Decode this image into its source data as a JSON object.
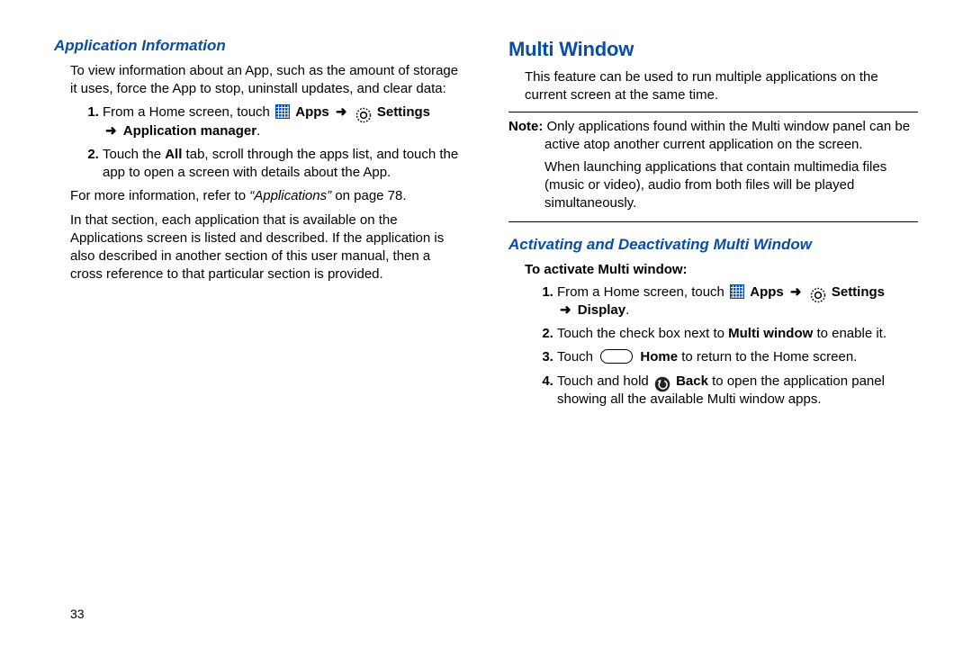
{
  "left": {
    "heading": "Application Information",
    "intro": "To view information about an App, such as the amount of storage it uses, force the App to stop, uninstall updates, and clear data:",
    "step1_pre": "From a Home screen, touch ",
    "apps_label": "Apps",
    "settings_label": "Settings",
    "step1_cont": "Application manager",
    "step2_a": "Touch the ",
    "step2_all": "All",
    "step2_b": " tab, scroll through the apps list, and touch the app to open a screen with details about the App.",
    "ref_a": "For more information, refer to ",
    "ref_i": "“Applications”",
    "ref_b": " on page 78.",
    "para2": "In that section, each application that is available on the Applications screen is listed and described. If the application is also described in another section of this user manual, then a cross reference to that particular section is provided."
  },
  "right": {
    "heading": "Multi Window",
    "intro": "This feature can be used to run multiple applications on the current screen at the same time.",
    "note_label": "Note:",
    "note1": "Only applications found within the Multi window panel can be active atop another current application on the screen.",
    "note2": "When launching applications that contain multimedia files (music or video), audio from both files will be played simultaneously.",
    "sub": "Activating and Deactivating Multi Window",
    "subhead": "To activate Multi window:",
    "step1_pre": "From a Home screen, touch ",
    "apps_label": "Apps",
    "settings_label": "Settings",
    "step1_cont": "Display",
    "step2_a": "Touch the check box next to ",
    "step2_bold": "Multi window",
    "step2_b": " to enable it.",
    "step3_a": "Touch ",
    "step3_bold": "Home",
    "step3_b": " to return to the Home screen.",
    "step4_a": "Touch and hold ",
    "step4_bold": "Back",
    "step4_b": " to open the application panel showing all the available Multi window apps."
  },
  "page": "33",
  "arrow": "➜"
}
